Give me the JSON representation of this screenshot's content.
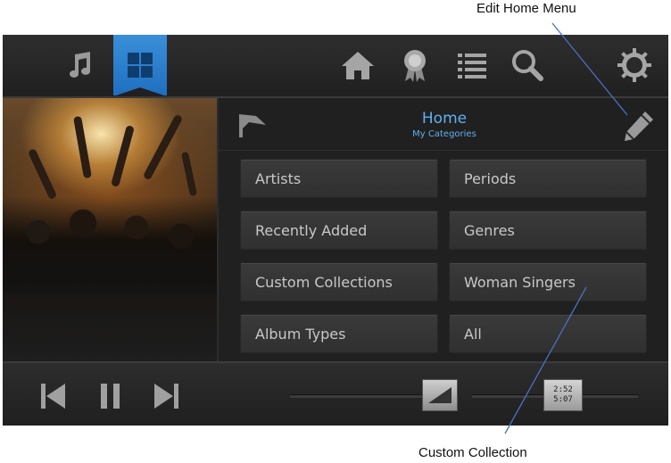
{
  "annotations": {
    "edit_home_menu": "Edit Home Menu",
    "custom_collection": "Custom Collection"
  },
  "topbar": {
    "left_icons": [
      "music-note-icon",
      "grid-icon"
    ],
    "right_icons": [
      "home-icon",
      "award-icon",
      "list-icon",
      "search-icon",
      "gear-icon"
    ],
    "active_tab": "grid-icon"
  },
  "header": {
    "title": "Home",
    "subtitle": "My Categories"
  },
  "categories": [
    {
      "label": "Artists"
    },
    {
      "label": "Periods"
    },
    {
      "label": "Recently Added"
    },
    {
      "label": "Genres"
    },
    {
      "label": "Custom Collections"
    },
    {
      "label": "Woman Singers"
    },
    {
      "label": "Album Types"
    },
    {
      "label": "All"
    }
  ],
  "player": {
    "elapsed": "2:52",
    "total": "5:07"
  },
  "colors": {
    "accent": "#3a8fd8",
    "title_text": "#5fb0f0"
  }
}
